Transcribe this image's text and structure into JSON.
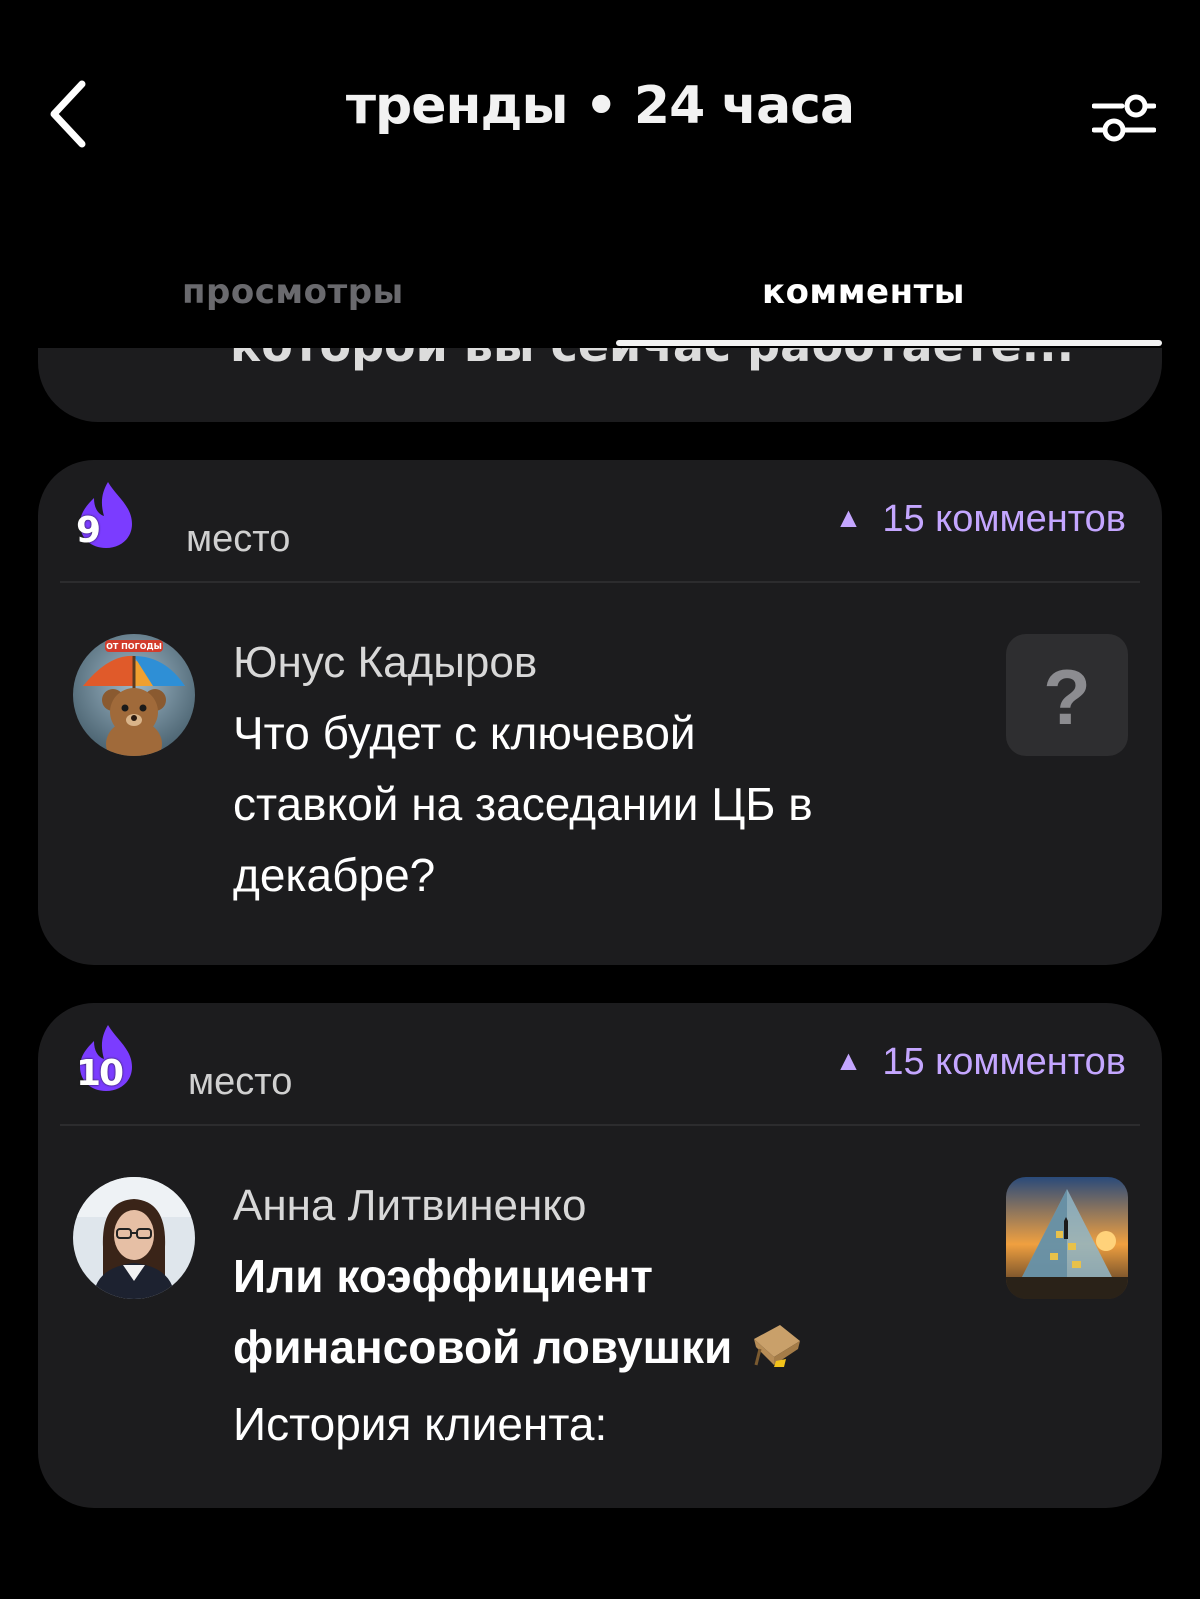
{
  "header": {
    "title": "тренды • 24 часа",
    "back_icon": "chevron-left-icon",
    "filter_icon": "sliders-icon"
  },
  "tabs": [
    {
      "label": "просмотры",
      "active": false
    },
    {
      "label": "комменты",
      "active": true
    }
  ],
  "partial_card": {
    "text": "которой вы сейчас работаете..."
  },
  "cards": [
    {
      "rank": "9",
      "rank_label": "место",
      "comments": "15 комментов",
      "author": "Юнус Кадыров",
      "lines": [
        "Что будет с ключевой",
        "ставкой на заседании ЦБ в",
        "декабре?"
      ],
      "thumb_symbol": "?",
      "avatar_caption": "ОТ ПОГОДЫ"
    },
    {
      "rank": "10",
      "rank_label": "место",
      "comments": "15 комментов",
      "author": "Анна Литвиненко",
      "bold_lines": [
        "Или коэффициент",
        "финансовой ловушки"
      ],
      "line": "История клиента:"
    }
  ],
  "colors": {
    "background": "#000000",
    "card": "#1c1c1e",
    "accent": "#c4a6ff",
    "flame": "#7b3cff"
  }
}
